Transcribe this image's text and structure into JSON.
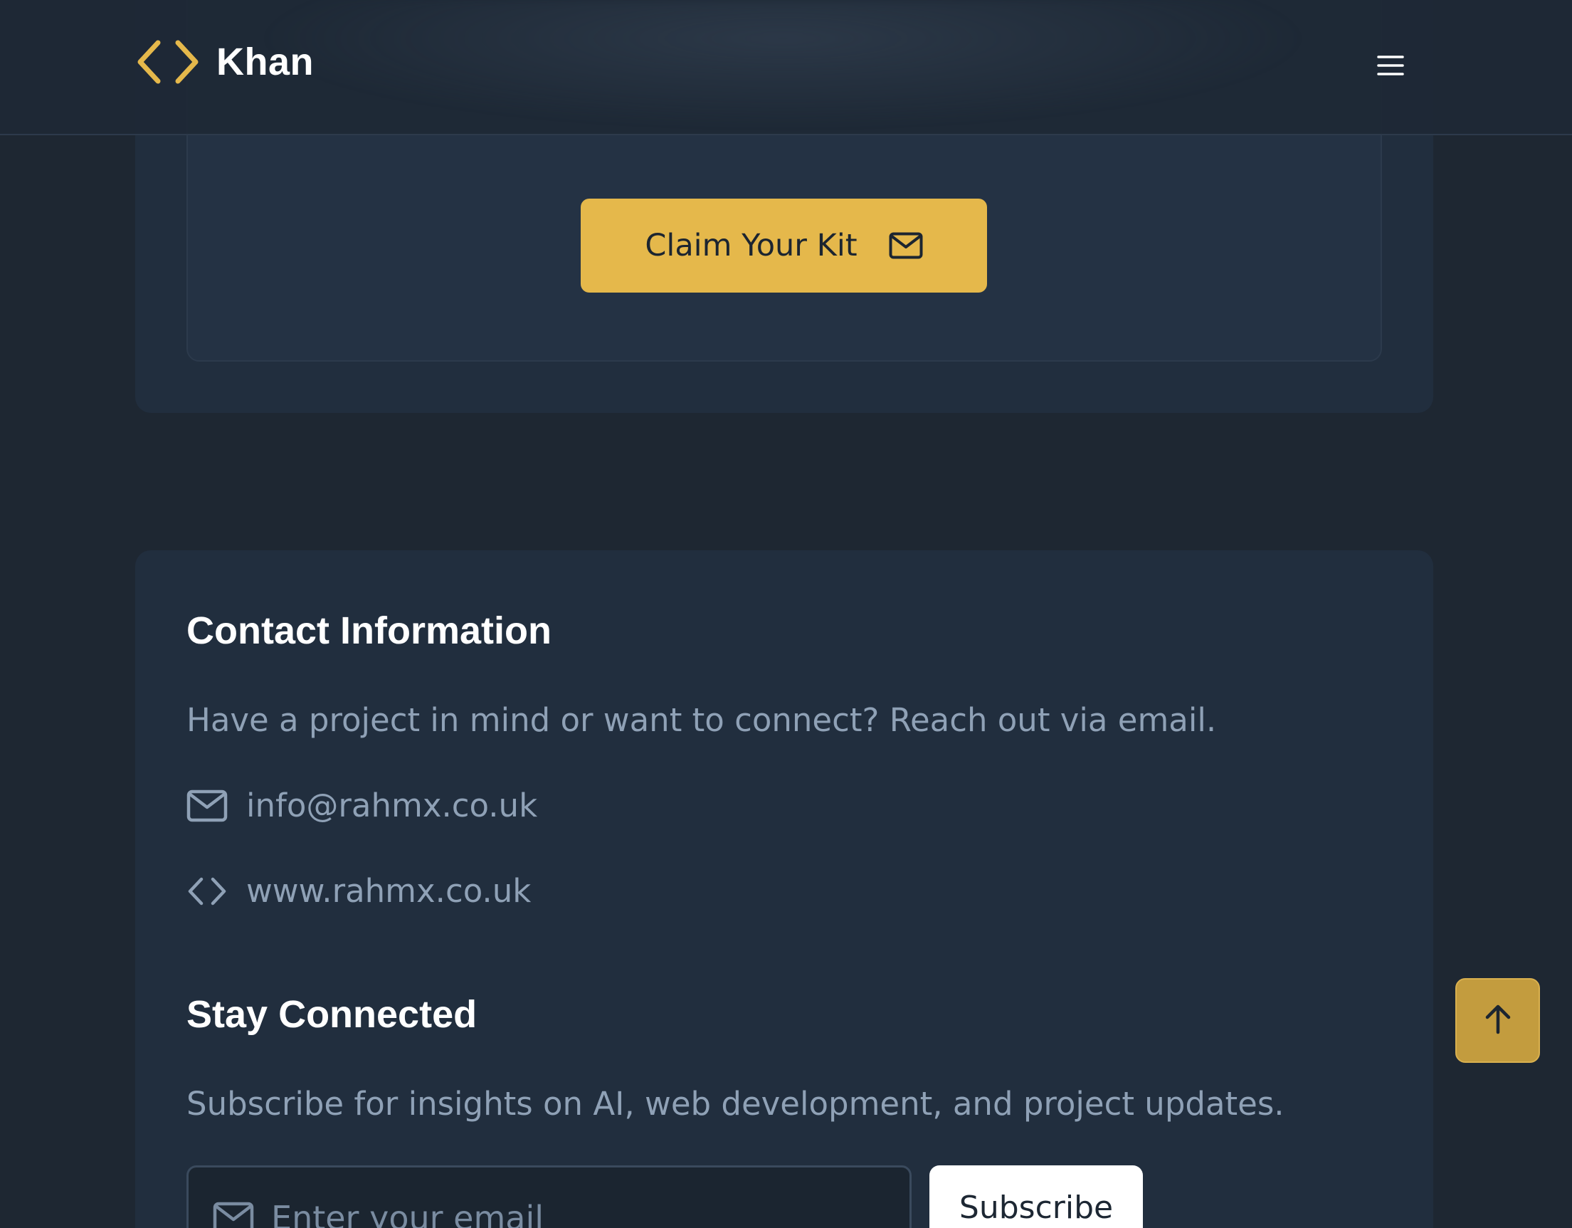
{
  "header": {
    "logo_text": "Khan",
    "logo_icon": "code-brackets-icon",
    "menu_icon": "hamburger-menu-icon"
  },
  "kit": {
    "button_label": "Claim Your Kit",
    "button_icon": "mail-icon"
  },
  "contact": {
    "title": "Contact Information",
    "description": "Have a project in mind or want to connect? Reach out via email.",
    "email": "info@rahmx.co.uk",
    "website": "www.rahmx.co.uk"
  },
  "newsletter": {
    "title": "Stay Connected",
    "description": "Subscribe for insights on AI, web development, and project updates.",
    "input_placeholder": "Enter your email",
    "subscribe_label": "Subscribe"
  },
  "back_to_top": {
    "icon": "arrow-up-icon"
  },
  "colors": {
    "accent": "#e5b84b",
    "background": "#1e2732",
    "card": "#212e3e",
    "muted_text": "#8fa1b6"
  }
}
